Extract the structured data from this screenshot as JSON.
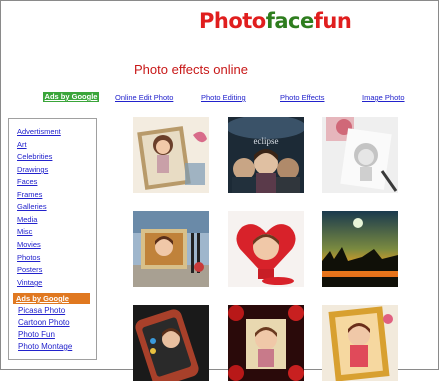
{
  "logo": {
    "part1": "Photo",
    "part2": "face",
    "part3": "fun"
  },
  "tagline": "Photo effects online",
  "top_nav": {
    "ads_label": "Ads by Google",
    "links": [
      "Online Edit Photo",
      "Photo Editing",
      "Photo Effects",
      "Image Photo"
    ]
  },
  "sidebar": {
    "categories": [
      "Advertisment",
      "Art",
      "Celebrities",
      "Drawings",
      "Faces",
      "Frames",
      "Galleries",
      "Media",
      "Misc",
      "Movies",
      "Photos",
      "Posters",
      "Vintage"
    ],
    "ads_label": "Ads by Google",
    "ad_links": [
      "Picasa Photo",
      "Cartoon Photo",
      "Photo Fun",
      "Photo Montage"
    ]
  },
  "thumbnails": [
    {
      "name": "caricature-girl-frame-thumb",
      "icon": "caricature-frame"
    },
    {
      "name": "eclipse-poster-thumb",
      "icon": "movie-poster",
      "caption": "eclipse"
    },
    {
      "name": "pencil-sketch-thumb",
      "icon": "pencil-drawing"
    },
    {
      "name": "street-billboard-thumb",
      "icon": "billboard"
    },
    {
      "name": "heart-frame-thumb",
      "icon": "heart-frame"
    },
    {
      "name": "sunset-silhouette-thumb",
      "icon": "sunset-scene"
    },
    {
      "name": "phone-screen-thumb",
      "icon": "mobile-phone"
    },
    {
      "name": "roses-frame-thumb",
      "icon": "roses-frame"
    },
    {
      "name": "gold-frame-thumb",
      "icon": "gold-frame"
    }
  ],
  "colors": {
    "logo_red": "#e01e1e",
    "logo_green": "#2e7d1e",
    "tagline": "#c81818",
    "link": "#2222cc",
    "ads_top_bg": "#3aa53a",
    "ads_side_bg": "#e07820"
  }
}
